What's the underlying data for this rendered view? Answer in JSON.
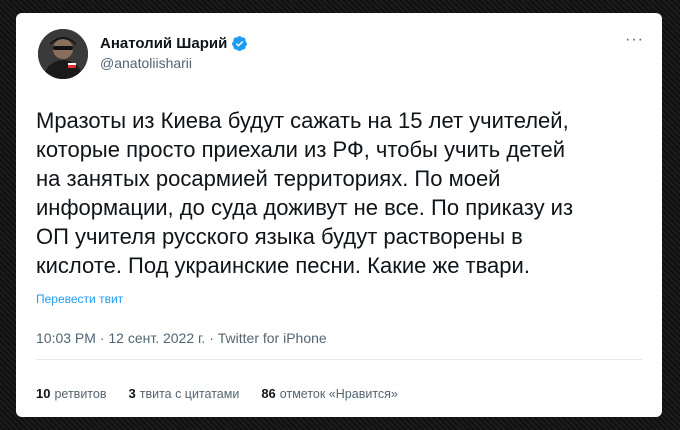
{
  "author": {
    "name": "Анатолий Шарий",
    "handle": "@anatoliisharii",
    "verified_color": "#1d9bf0"
  },
  "menu_icon": "more-horizontal-icon",
  "tweet": {
    "text": "Мразоты из Киева будут сажать на 15 лет учителей,\nкоторые просто приехали из РФ, чтобы учить детей\nна занятых росармией территориях. По моей\nинформации, до суда доживут не все. По приказу из\nОП учителя русского языка будут растворены в\nкислоте. Под украинские песни. Какие же твари.",
    "translate_label": "Перевести твит",
    "meta": "10:03 PM · 12 сент. 2022 г. · Twitter for iPhone"
  },
  "stats": {
    "retweets_count": "10",
    "retweets_label": "ретвитов",
    "quotes_count": "3",
    "quotes_label": "твита с цитатами",
    "likes_count": "86",
    "likes_label": "отметок «Нравится»"
  }
}
